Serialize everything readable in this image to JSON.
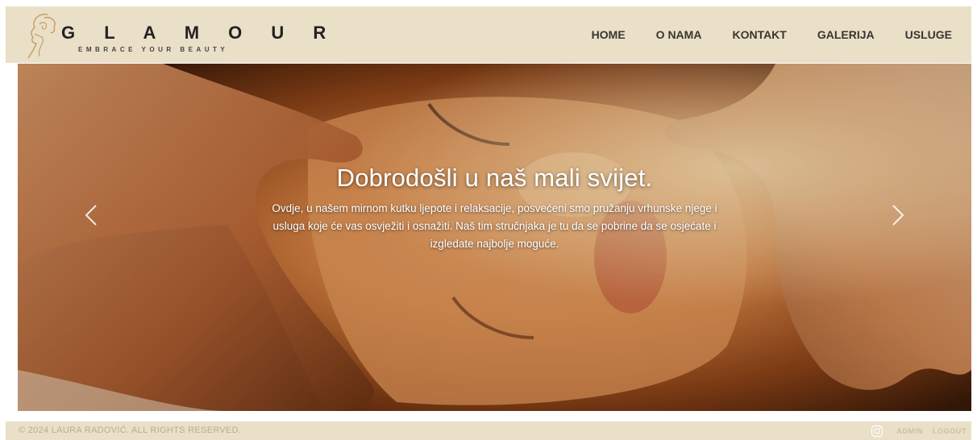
{
  "brand": {
    "name": "G L A M O U R",
    "tagline": "EMBRACE YOUR BEAUTY",
    "icon": "face-profile-logo"
  },
  "nav": {
    "items": [
      {
        "label": "HOME"
      },
      {
        "label": "O NAMA"
      },
      {
        "label": "KONTAKT"
      },
      {
        "label": "GALERIJA"
      },
      {
        "label": "USLUGE"
      }
    ]
  },
  "hero": {
    "title": "Dobrodošli u naš mali svijet.",
    "text": "Ovdje, u našem mirnom kutku ljepote i relaksacije, posvećeni smo pružanju vrhunske njege i usluga koje će vas osvježiti i osnažiti. Naš tim stručnjaka je tu da se pobrine da se osjećate i izgledate najbolje moguće.",
    "prev_icon": "chevron-left-icon",
    "next_icon": "chevron-right-icon"
  },
  "footer": {
    "copyright": "© 2024 LAURA RADOVIĆ. ALL RIGHTS RESERVED.",
    "admin_label": "ADMIN",
    "logout_label": "LOGOUT",
    "social_icon": "instagram-icon"
  },
  "colors": {
    "header_bg": "#eadfc7",
    "footer_bg": "#eadfc7",
    "nav_text": "#3a3530",
    "accent_gold": "#c49a5c"
  }
}
